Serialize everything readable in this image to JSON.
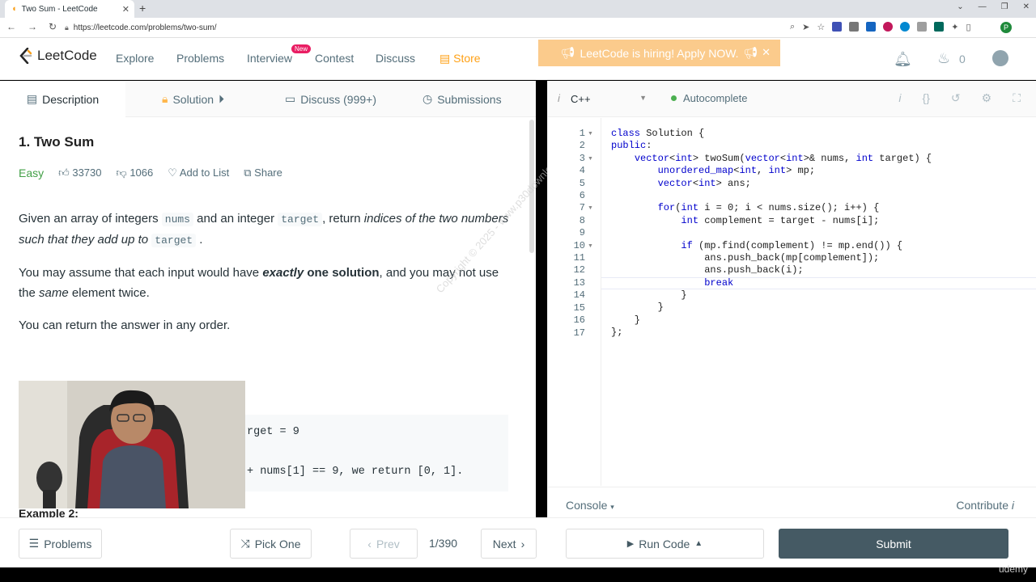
{
  "browser": {
    "tab_title": "Two Sum - LeetCode",
    "url": "https://leetcode.com/problems/two-sum/",
    "profile_initial": "P"
  },
  "nav": {
    "logo": "LeetCode",
    "items": [
      "Explore",
      "Problems",
      "Interview",
      "Contest",
      "Discuss"
    ],
    "new_badge": "New",
    "store": "Store",
    "hiring_banner": "LeetCode is hiring! Apply NOW.",
    "fire_count": "0"
  },
  "left_tabs": {
    "description": "Description",
    "solution": "Solution",
    "discuss": "Discuss (999+)",
    "submissions": "Submissions"
  },
  "problem": {
    "title": "1. Two Sum",
    "difficulty": "Easy",
    "likes": "33730",
    "dislikes": "1066",
    "add_to_list": "Add to List",
    "share": "Share",
    "desc_p1_a": "Given an array of integers",
    "nums": "nums",
    "desc_p1_b": "and an integer",
    "target": "target",
    "desc_p1_c": ", return",
    "desc_p1_em": "indices of the two numbers such that they add up to",
    "desc_p1_end": ".",
    "desc_p2_a": "You may assume that each input would have",
    "desc_p2_em": "exactly",
    "desc_p2_strong": "one solution",
    "desc_p2_b": ", and you may not use the",
    "desc_p2_em2": "same",
    "desc_p2_c": "element twice.",
    "desc_p3": "You can return the answer in any order.",
    "example_line1": "rget = 9",
    "example_line2": "+ nums[1] == 9, we return [0, 1].",
    "example2_heading": "Example 2:"
  },
  "watermark": "Copyright © 2025 - www.p30download.com",
  "editor": {
    "language": "C++",
    "autocomplete": "Autocomplete",
    "line_numbers": [
      "1",
      "2",
      "3",
      "4",
      "5",
      "6",
      "7",
      "8",
      "9",
      "10",
      "11",
      "12",
      "13",
      "14",
      "15",
      "16",
      "17"
    ],
    "code_lines": [
      "class Solution {",
      "public:",
      "    vector<int> twoSum(vector<int>& nums, int target) {",
      "        unordered_map<int, int> mp;",
      "        vector<int> ans;",
      "",
      "        for(int i = 0; i < nums.size(); i++) {",
      "            int complement = target - nums[i];",
      "",
      "            if (mp.find(complement) != mp.end()) {",
      "                ans.push_back(mp[complement]);",
      "                ans.push_back(i);",
      "                break",
      "            }",
      "        }",
      "    }",
      "};"
    ],
    "console": "Console",
    "contribute": "Contribute"
  },
  "bottom": {
    "problems": "Problems",
    "pick_one": "Pick One",
    "prev": "Prev",
    "page": "1/390",
    "next": "Next",
    "run_code": "Run Code",
    "submit": "Submit"
  },
  "udemy": "udemy"
}
